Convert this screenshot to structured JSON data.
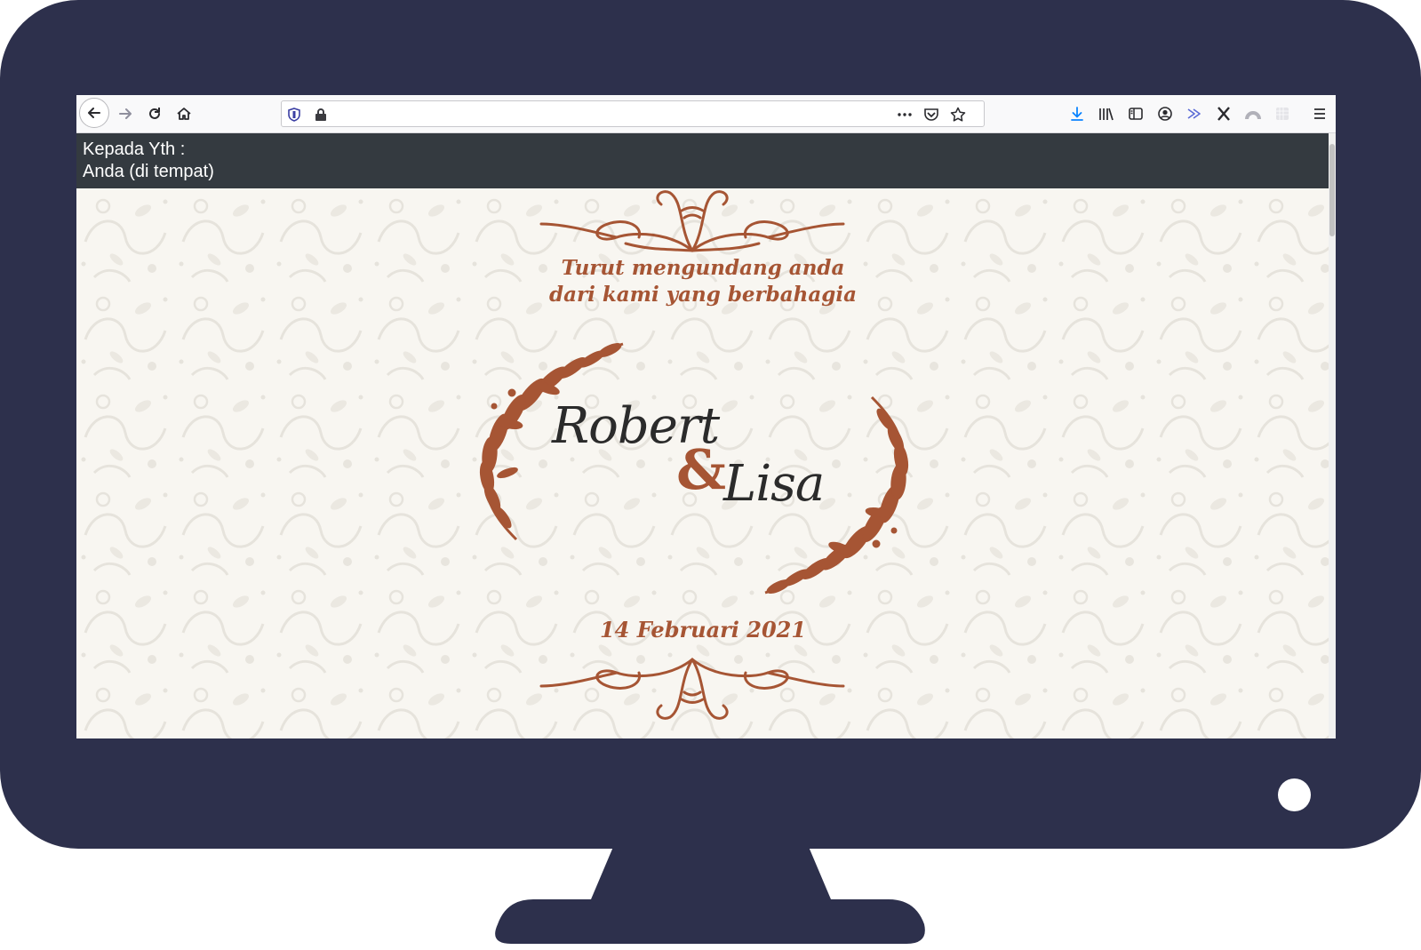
{
  "browser": {
    "url": "",
    "icons": {
      "back": "arrow-left-icon",
      "forward": "arrow-right-icon",
      "reload": "reload-icon",
      "home": "home-icon",
      "tracking": "shield-icon",
      "lock": "lock-icon",
      "more": "ellipsis-icon",
      "pocket": "pocket-icon",
      "bookmark": "star-icon",
      "downloads": "download-icon",
      "library": "library-icon",
      "sidebar": "sidebar-icon",
      "account": "account-icon",
      "send": "send-icon",
      "extension_x": "x-extension-icon",
      "extension_arc": "arc-extension-icon",
      "extension_grid": "grid-extension-icon",
      "menu": "hamburger-menu-icon"
    }
  },
  "greeting": {
    "line1": "Kepada Yth :",
    "line2": "Anda (di tempat)"
  },
  "invitation": {
    "intro_line1": "Turut mengundang anda",
    "intro_line2": "dari kami yang berbahagia",
    "groom": "Robert",
    "ampersand": "&",
    "bride": "Lisa",
    "date": "14 Februari 2021"
  },
  "colors": {
    "accent": "#a65534",
    "monitor": "#2d304c",
    "greeting_bar": "#343a40",
    "background": "#f8f6f1"
  }
}
